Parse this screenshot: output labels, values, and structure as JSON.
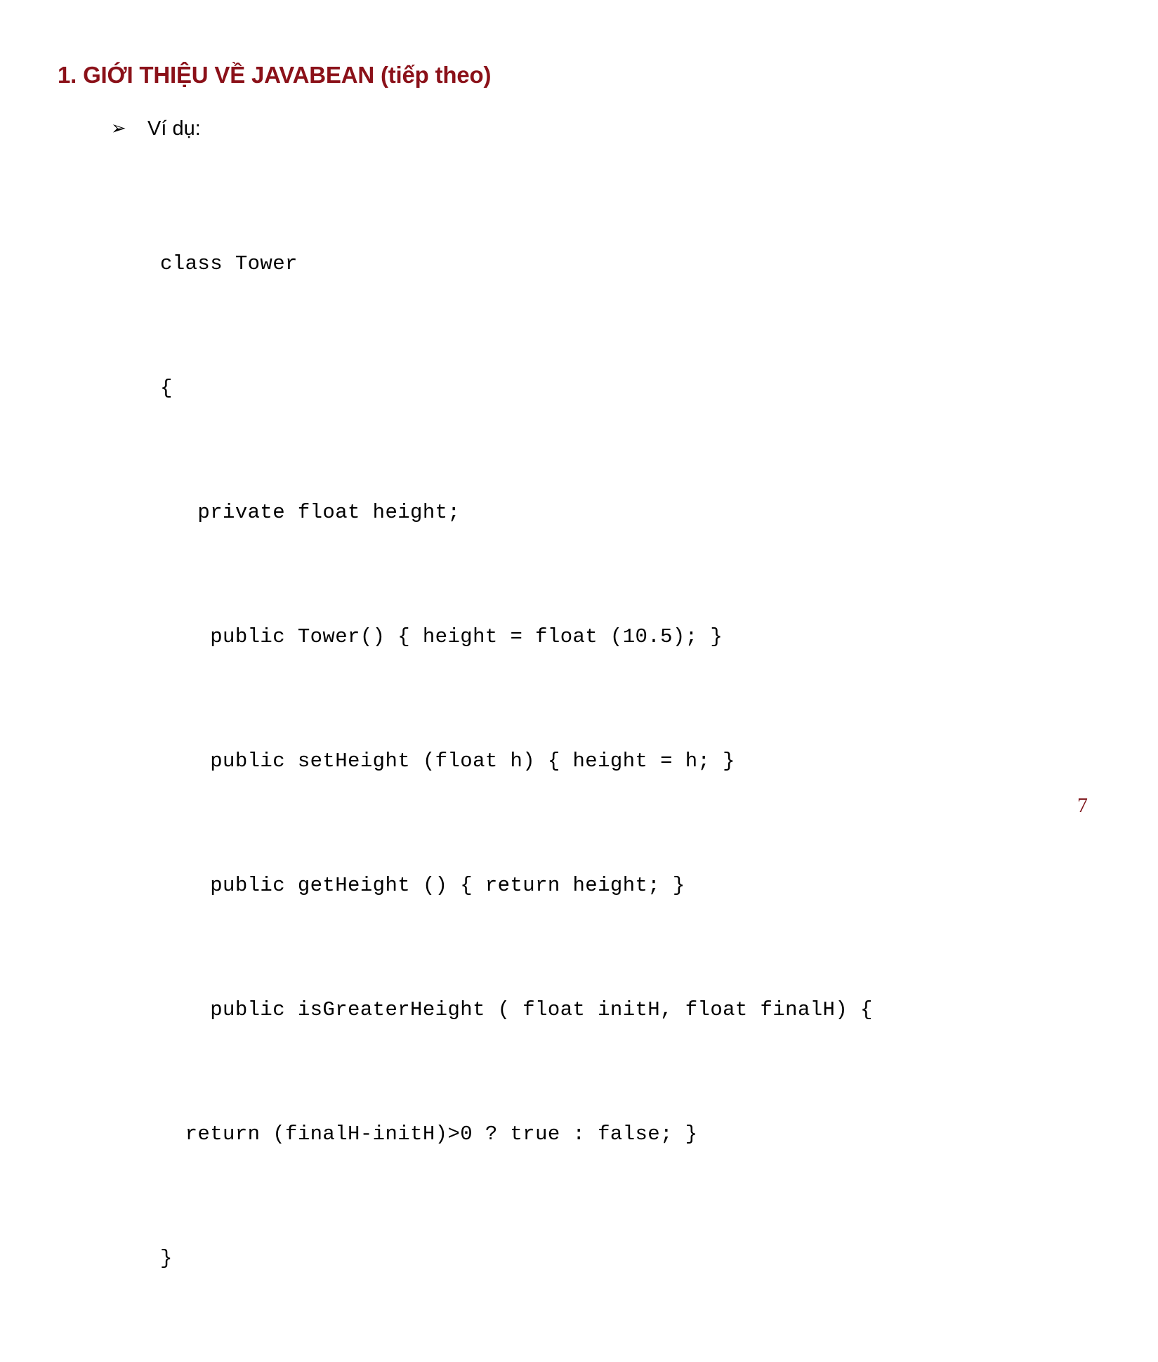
{
  "slide": {
    "title": "1. GIỚI THIỆU VỀ JAVABEAN (tiếp theo)",
    "title_color": "#8B1119",
    "background_color": "#FFFFFF",
    "page_number": "7",
    "page_number_color": "#7B1016"
  },
  "bullet": {
    "marker": "➢",
    "marker_name": "arrowhead-bullet",
    "text": "Ví dụ:"
  },
  "code": {
    "language": "java",
    "lines": [
      "class Tower",
      "{",
      "   private float height;",
      "    public Tower() { height = float (10.5); }",
      "    public setHeight (float h) { height = h; }",
      "    public getHeight () { return height; }",
      "    public isGreaterHeight ( float initH, float finalH) {",
      "  return (finalH-initH)>0 ? true : false; }",
      "}"
    ]
  }
}
